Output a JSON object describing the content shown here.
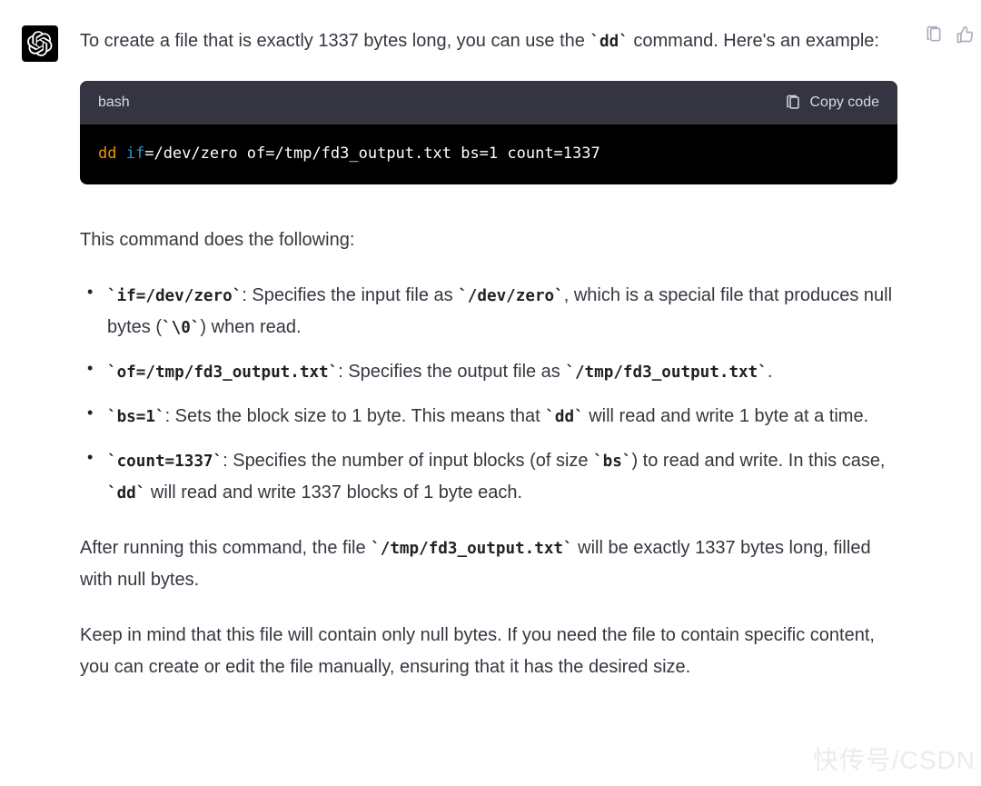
{
  "intro": {
    "pre": "To create a file that is exactly 1337 bytes long, you can use the ",
    "cmd": "`dd`",
    "post": " command. Here's an example:"
  },
  "code": {
    "lang": "bash",
    "copy_label": "Copy code",
    "tokens": {
      "cmd": "dd",
      "kw": "if",
      "rest": "=/dev/zero of=/tmp/fd3_output.txt bs=1 count=1337"
    }
  },
  "explain_heading": "This command does the following:",
  "bullets": [
    {
      "code": "`if=/dev/zero`",
      "t1": ": Specifies the input file as ",
      "c2": "`/dev/zero`",
      "t2": ", which is a special file that produces null bytes (",
      "c3": "`\\0`",
      "t3": ") when read."
    },
    {
      "code": "`of=/tmp/fd3_output.txt`",
      "t1": ": Specifies the output file as ",
      "c2": "`/tmp/fd3_output.txt`",
      "t2": ".",
      "c3": "",
      "t3": ""
    },
    {
      "code": "`bs=1`",
      "t1": ": Sets the block size to 1 byte. This means that ",
      "c2": "`dd`",
      "t2": " will read and write 1 byte at a time.",
      "c3": "",
      "t3": ""
    },
    {
      "code": "`count=1337`",
      "t1": ": Specifies the number of input blocks (of size ",
      "c2": "`bs`",
      "t2": ") to read and write. In this case, ",
      "c3": "`dd`",
      "t3": " will read and write 1337 blocks of 1 byte each."
    }
  ],
  "after": {
    "pre": "After running this command, the file ",
    "code": "`/tmp/fd3_output.txt`",
    "post": " will be exactly 1337 bytes long, filled with null bytes."
  },
  "note": "Keep in mind that this file will contain only null bytes. If you need the file to contain specific content, you can create or edit the file manually, ensuring that it has the desired size.",
  "watermark": "快传号/CSDN"
}
